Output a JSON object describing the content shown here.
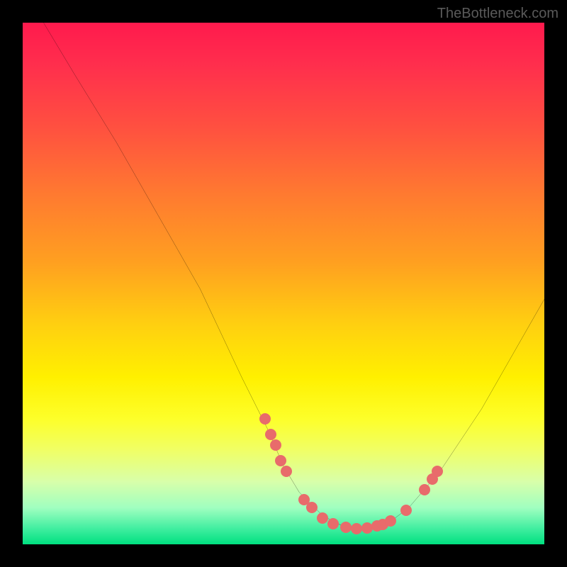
{
  "watermark": "TheBottleneck.com",
  "chart_data": {
    "type": "line",
    "title": "",
    "xlabel": "",
    "ylabel": "",
    "xlim": [
      0,
      100
    ],
    "ylim": [
      0,
      100
    ],
    "series": [
      {
        "name": "curve",
        "x": [
          4,
          10,
          18,
          26,
          34,
          42,
          47,
          50,
          53,
          57,
          60,
          64,
          67,
          70,
          74,
          80,
          88,
          96,
          100
        ],
        "y": [
          100,
          90,
          77,
          63,
          49,
          32,
          22,
          15,
          10,
          6,
          4,
          3,
          3,
          4,
          7,
          14,
          26,
          40,
          47
        ]
      }
    ],
    "markers": [
      {
        "x": 46.5,
        "y": 24
      },
      {
        "x": 47.5,
        "y": 21
      },
      {
        "x": 48.5,
        "y": 19
      },
      {
        "x": 49.5,
        "y": 16
      },
      {
        "x": 50.5,
        "y": 14
      },
      {
        "x": 54,
        "y": 8.5
      },
      {
        "x": 55.5,
        "y": 7
      },
      {
        "x": 57.5,
        "y": 5
      },
      {
        "x": 59.5,
        "y": 4
      },
      {
        "x": 62,
        "y": 3.3
      },
      {
        "x": 64,
        "y": 3
      },
      {
        "x": 66,
        "y": 3.1
      },
      {
        "x": 68,
        "y": 3.5
      },
      {
        "x": 69,
        "y": 3.8
      },
      {
        "x": 70.5,
        "y": 4.5
      },
      {
        "x": 73.5,
        "y": 6.5
      },
      {
        "x": 77,
        "y": 10.5
      },
      {
        "x": 78.5,
        "y": 12.5
      },
      {
        "x": 79.5,
        "y": 14
      }
    ]
  }
}
